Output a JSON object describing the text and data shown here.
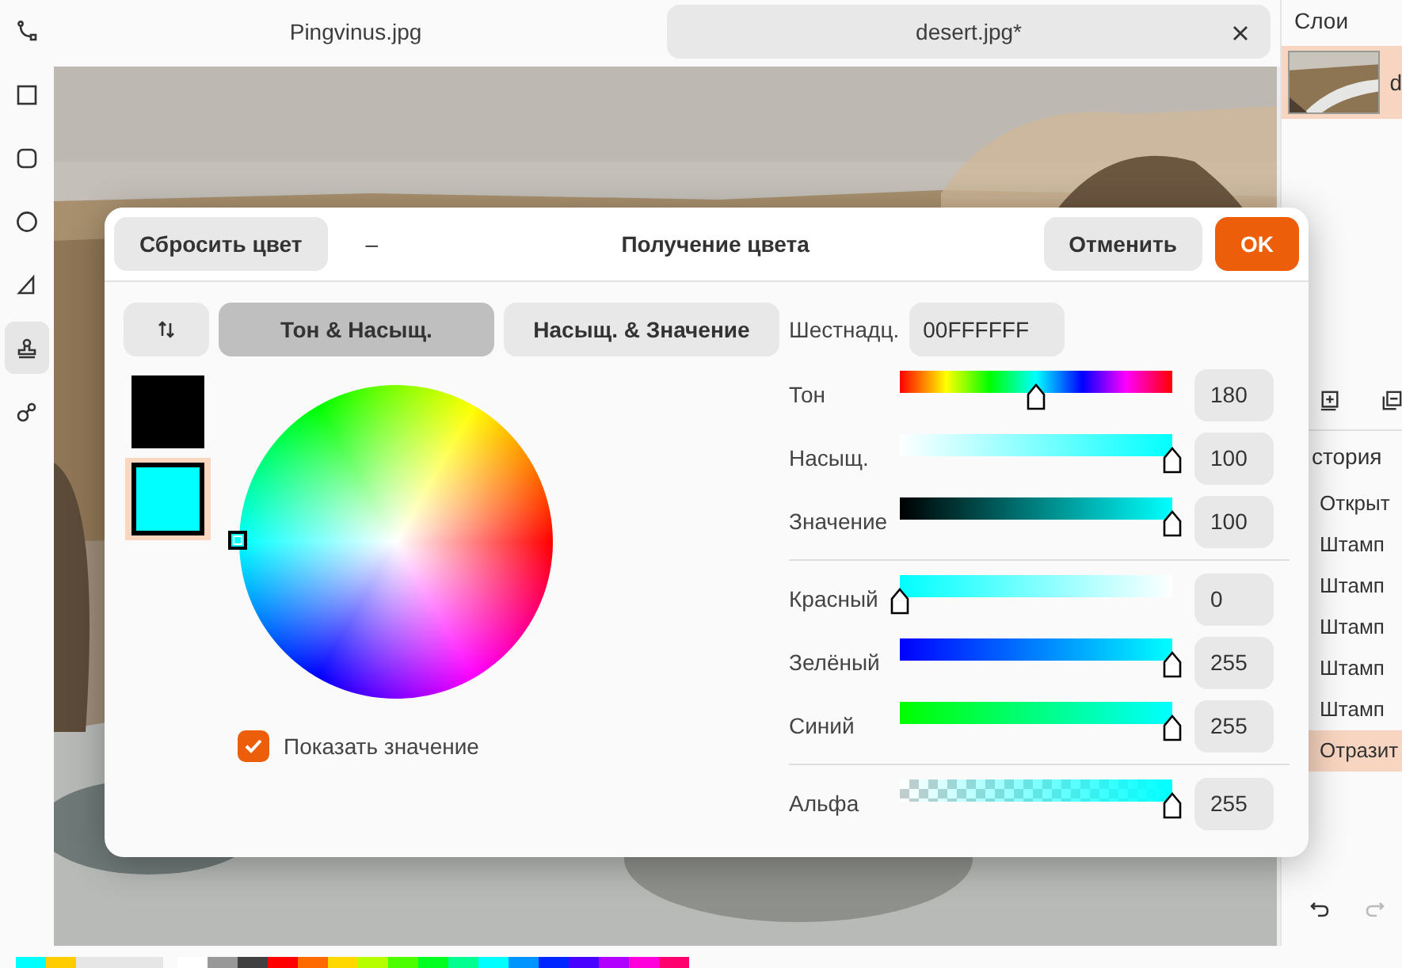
{
  "tools": [
    {
      "kind": "path",
      "selected": false
    },
    {
      "kind": "rectangle",
      "selected": false
    },
    {
      "kind": "rounded-rectangle",
      "selected": false
    },
    {
      "kind": "ellipse",
      "selected": false
    },
    {
      "kind": "freeform",
      "selected": false
    },
    {
      "kind": "stamp",
      "selected": true
    },
    {
      "kind": "recolor",
      "selected": false
    }
  ],
  "tabs": [
    {
      "label": "Pingvinus.jpg",
      "selected": false
    },
    {
      "label": "desert.jpg*",
      "selected": true
    }
  ],
  "layers_panel": {
    "title": "Слои",
    "layers": [
      {
        "name": "d",
        "selected": true
      }
    ]
  },
  "history_panel": {
    "title": "стория",
    "items": [
      {
        "label": "Открыт",
        "selected": false
      },
      {
        "label": "Штамп",
        "selected": false
      },
      {
        "label": "Штамп",
        "selected": false
      },
      {
        "label": "Штамп",
        "selected": false
      },
      {
        "label": "Штамп",
        "selected": false
      },
      {
        "label": "Штамп",
        "selected": false
      },
      {
        "label": "Отразит",
        "selected": true
      }
    ]
  },
  "palette": {
    "current": [
      {
        "color": "#00ffff"
      },
      {
        "color": "#ffcc00"
      }
    ],
    "swatches": [
      {
        "color": "#ffffff"
      },
      {
        "color": "#999999"
      },
      {
        "color": "#404040"
      },
      {
        "color": "#ff0000"
      },
      {
        "color": "#ff6a00"
      },
      {
        "color": "#ffd800"
      },
      {
        "color": "#b6ff00"
      },
      {
        "color": "#4cff00"
      },
      {
        "color": "#00ff21"
      },
      {
        "color": "#00ff90"
      },
      {
        "color": "#00ffff"
      },
      {
        "color": "#0094ff"
      },
      {
        "color": "#0026ff"
      },
      {
        "color": "#4800ff"
      },
      {
        "color": "#b200ff"
      },
      {
        "color": "#ff00dc"
      },
      {
        "color": "#ff006e"
      }
    ]
  },
  "dialog": {
    "title": "Получение цвета",
    "reset_label": "Сбросить цвет",
    "minimize": "–",
    "cancel_label": "Отменить",
    "ok_label": "OK",
    "modes": [
      {
        "label": "Тон & Насыщ.",
        "selected": true
      },
      {
        "label": "Насыщ. & Значение",
        "selected": false
      }
    ],
    "hex_label": "Шестнадц.",
    "hex_value": "00FFFFFF",
    "swatches": [
      {
        "color": "#000000",
        "selected": false
      },
      {
        "color": "#00ffff",
        "selected": true
      }
    ],
    "show_value": {
      "label": "Показать значение",
      "checked": true
    },
    "slider_groups": [
      [
        {
          "kind": "hue",
          "label": "Тон",
          "level": 0.5,
          "value": "180"
        },
        {
          "kind": "saturation",
          "label": "Насыщ.",
          "level": 1,
          "value": "100"
        },
        {
          "kind": "value",
          "label": "Значение",
          "level": 1,
          "value": "100"
        }
      ],
      [
        {
          "kind": "red",
          "label": "Красный",
          "level": 0,
          "value": "0"
        },
        {
          "kind": "green",
          "label": "Зелёный",
          "level": 1,
          "value": "255"
        },
        {
          "kind": "blue",
          "label": "Синий",
          "level": 1,
          "value": "255"
        }
      ],
      [
        {
          "kind": "alpha",
          "label": "Альфа",
          "level": 1,
          "value": "255"
        }
      ]
    ]
  }
}
